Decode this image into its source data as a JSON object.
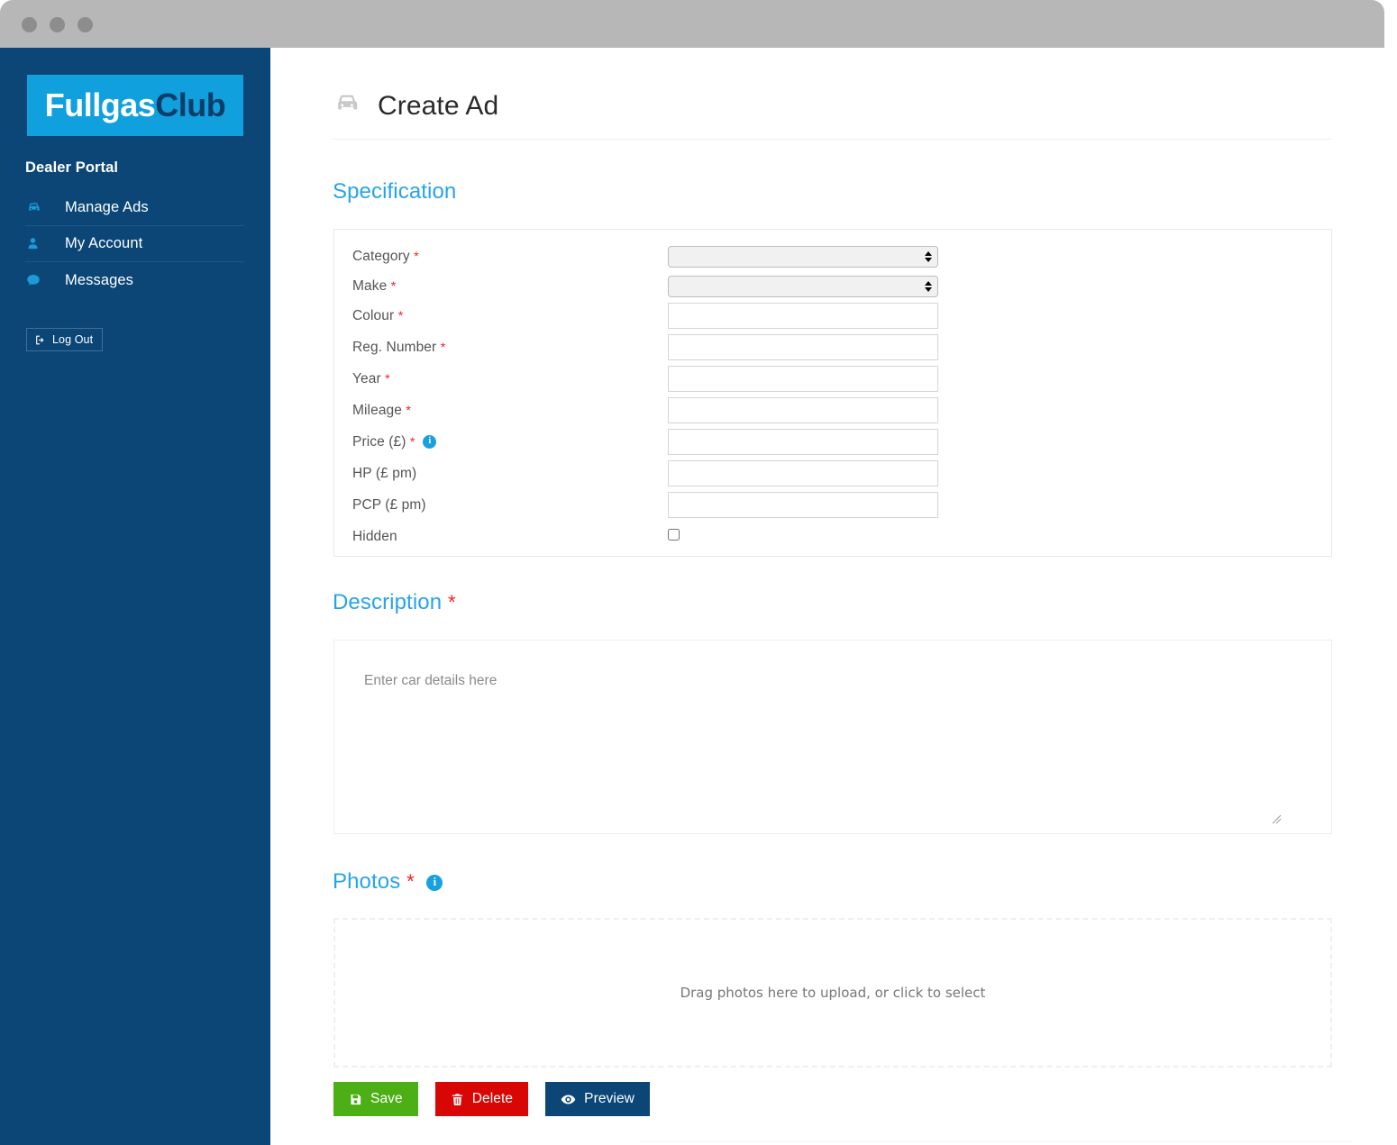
{
  "window": {
    "dots": [
      "window-dot-1",
      "window-dot-2",
      "window-dot-3"
    ]
  },
  "sidebar": {
    "logo": {
      "part1": "Fullgas",
      "part2": "Club",
      "bg": "#10a0dd"
    },
    "portal_title": "Dealer Portal",
    "items": [
      {
        "label": "Manage Ads",
        "icon": "car-icon"
      },
      {
        "label": "My Account",
        "icon": "user-icon"
      },
      {
        "label": "Messages",
        "icon": "chat-icon"
      }
    ],
    "logout": {
      "label": "Log Out",
      "icon": "logout-icon"
    },
    "bg": "#0b4677",
    "accent": "#1b9ad6"
  },
  "header": {
    "title": "Create Ad",
    "icon": "car-icon"
  },
  "specification": {
    "section_label": "Specification",
    "fields": [
      {
        "label": "Category",
        "required": true,
        "type": "select",
        "value": "",
        "info": false
      },
      {
        "label": "Make",
        "required": true,
        "type": "select",
        "value": "",
        "info": false
      },
      {
        "label": "Colour",
        "required": true,
        "type": "text",
        "value": "",
        "info": false
      },
      {
        "label": "Reg. Number",
        "required": true,
        "type": "text",
        "value": "",
        "info": false
      },
      {
        "label": "Year",
        "required": true,
        "type": "text",
        "value": "",
        "info": false
      },
      {
        "label": "Mileage",
        "required": true,
        "type": "text",
        "value": "",
        "info": false
      },
      {
        "label": "Price (£)",
        "required": true,
        "type": "text",
        "value": "",
        "info": true
      },
      {
        "label": "HP (£ pm)",
        "required": false,
        "type": "text",
        "value": "",
        "info": false
      },
      {
        "label": "PCP (£ pm)",
        "required": false,
        "type": "text",
        "value": "",
        "info": false
      },
      {
        "label": "Hidden",
        "required": false,
        "type": "checkbox",
        "value": "",
        "checked": false,
        "info": false
      }
    ],
    "required_marker": "*",
    "info_glyph": "i"
  },
  "description": {
    "section_label": "Description",
    "required_marker": "*",
    "placeholder": "Enter car details here",
    "value": ""
  },
  "photos": {
    "section_label": "Photos",
    "required_marker": "*",
    "info_glyph": "i",
    "dropzone_text": "Drag photos here to upload, or click to select"
  },
  "actions": [
    {
      "label": "Save",
      "icon": "save-icon",
      "color": "#4caf15"
    },
    {
      "label": "Delete",
      "icon": "trash-icon",
      "color": "#d90606"
    },
    {
      "label": "Preview",
      "icon": "eye-icon",
      "color": "#0b4677"
    }
  ]
}
